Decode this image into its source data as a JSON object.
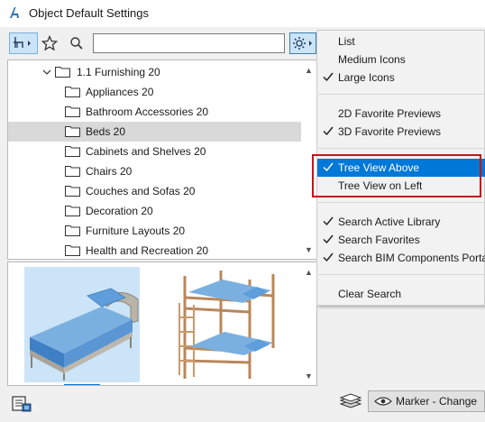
{
  "window": {
    "title": "Object Default Settings"
  },
  "toolbar": {
    "search_value": "",
    "search_placeholder": ""
  },
  "tree": {
    "parent": {
      "label": "1.1 Furnishing 20",
      "expanded": true
    },
    "items": [
      {
        "label": "Appliances 20",
        "selected": false
      },
      {
        "label": "Bathroom Accessories 20",
        "selected": false
      },
      {
        "label": "Beds 20",
        "selected": true
      },
      {
        "label": "Cabinets and Shelves 20",
        "selected": false
      },
      {
        "label": "Chairs 20",
        "selected": false
      },
      {
        "label": "Couches and Sofas 20",
        "selected": false
      },
      {
        "label": "Decoration 20",
        "selected": false
      },
      {
        "label": "Furniture Layouts 20",
        "selected": false
      },
      {
        "label": "Health and Recreation 20",
        "selected": false
      }
    ]
  },
  "previews": [
    {
      "name": "single-bed",
      "selected": true
    },
    {
      "name": "bunk-bed",
      "selected": false
    }
  ],
  "menu": {
    "groups": [
      [
        {
          "label": "List",
          "checked": false
        },
        {
          "label": "Medium Icons",
          "checked": false
        },
        {
          "label": "Large Icons",
          "checked": true
        }
      ],
      [
        {
          "label": "2D Favorite Previews",
          "checked": false
        },
        {
          "label": "3D Favorite Previews",
          "checked": true
        }
      ],
      [
        {
          "label": "Tree View Above",
          "checked": true,
          "highlighted": true
        },
        {
          "label": "Tree View on Left",
          "checked": false
        }
      ],
      [
        {
          "label": "Search Active Library",
          "checked": true
        },
        {
          "label": "Search Favorites",
          "checked": true
        },
        {
          "label": "Search BIM Components Portal",
          "checked": true
        }
      ],
      [
        {
          "label": "Clear Search",
          "checked": false
        }
      ]
    ]
  },
  "bottom": {
    "marker_label": "Marker - Change"
  },
  "colors": {
    "accent": "#0078d7",
    "selection_bg": "#cce4f7",
    "annotation": "#c0161e"
  }
}
